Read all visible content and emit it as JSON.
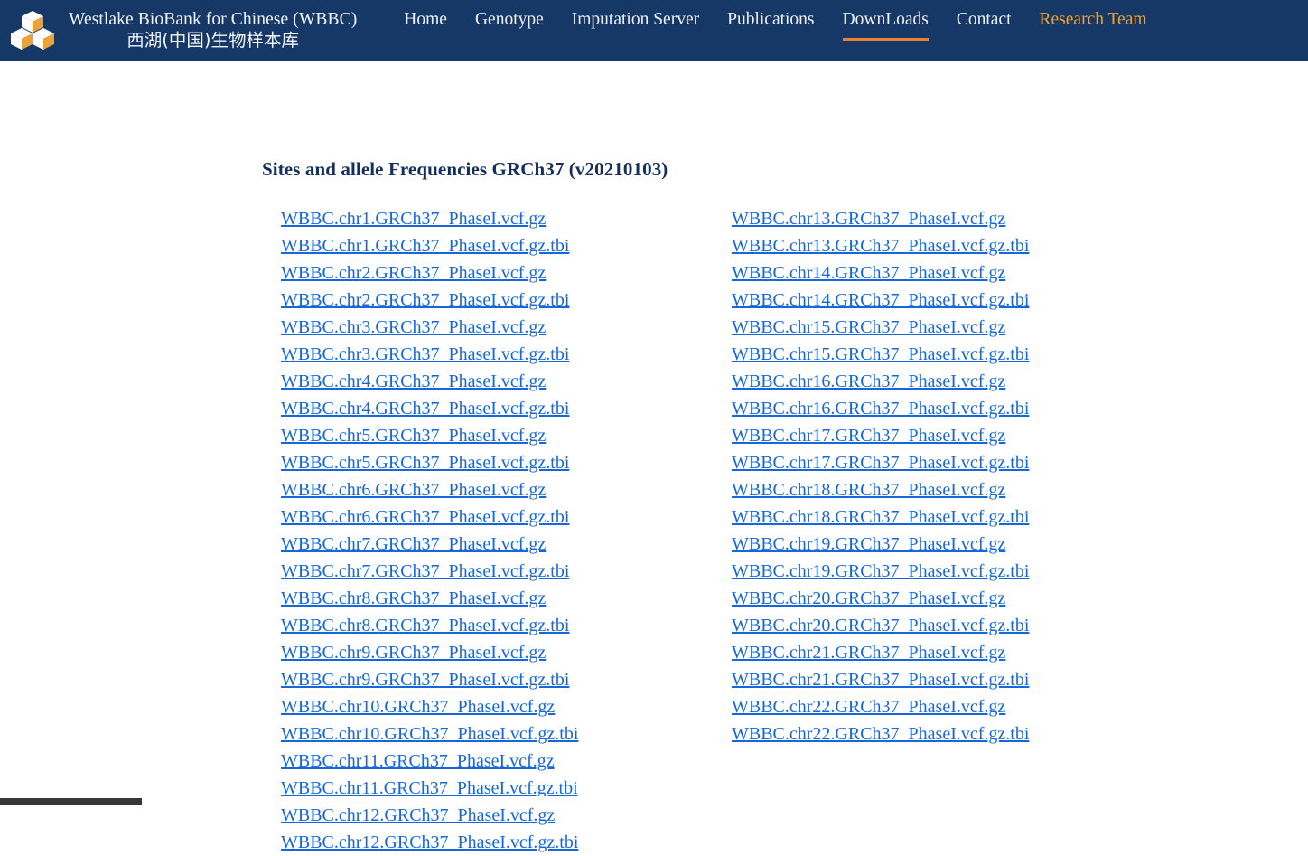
{
  "header": {
    "logo_icon": "three-cubes-logo-icon",
    "brand_title_en": "Westlake BioBank for Chinese (WBBC)",
    "brand_title_cn": "西湖(中国)生物样本库",
    "background_color": "#163867",
    "active_underline_color": "#e8803a",
    "accent_text_color": "#f0a32e",
    "nav": [
      {
        "label": "Home",
        "active": false,
        "accent": false
      },
      {
        "label": "Genotype",
        "active": false,
        "accent": false
      },
      {
        "label": "Imputation Server",
        "active": false,
        "accent": false
      },
      {
        "label": "Publications",
        "active": false,
        "accent": false
      },
      {
        "label": "DownLoads",
        "active": true,
        "accent": false
      },
      {
        "label": "Contact",
        "active": false,
        "accent": false
      },
      {
        "label": "Research Team",
        "active": false,
        "accent": true
      }
    ]
  },
  "main": {
    "heading": "Sites and allele Frequencies GRCh37 (v20210103)",
    "heading_color": "#132f5e",
    "link_color": "#1668da",
    "columns": [
      {
        "name": "chr1-chr12",
        "links": [
          "WBBC.chr1.GRCh37_PhaseI.vcf.gz",
          "WBBC.chr1.GRCh37_PhaseI.vcf.gz.tbi",
          "WBBC.chr2.GRCh37_PhaseI.vcf.gz",
          "WBBC.chr2.GRCh37_PhaseI.vcf.gz.tbi",
          "WBBC.chr3.GRCh37_PhaseI.vcf.gz",
          "WBBC.chr3.GRCh37_PhaseI.vcf.gz.tbi",
          "WBBC.chr4.GRCh37_PhaseI.vcf.gz",
          "WBBC.chr4.GRCh37_PhaseI.vcf.gz.tbi",
          "WBBC.chr5.GRCh37_PhaseI.vcf.gz",
          "WBBC.chr5.GRCh37_PhaseI.vcf.gz.tbi",
          "WBBC.chr6.GRCh37_PhaseI.vcf.gz",
          "WBBC.chr6.GRCh37_PhaseI.vcf.gz.tbi",
          "WBBC.chr7.GRCh37_PhaseI.vcf.gz",
          "WBBC.chr7.GRCh37_PhaseI.vcf.gz.tbi",
          "WBBC.chr8.GRCh37_PhaseI.vcf.gz",
          "WBBC.chr8.GRCh37_PhaseI.vcf.gz.tbi",
          "WBBC.chr9.GRCh37_PhaseI.vcf.gz",
          "WBBC.chr9.GRCh37_PhaseI.vcf.gz.tbi",
          "WBBC.chr10.GRCh37_PhaseI.vcf.gz",
          "WBBC.chr10.GRCh37_PhaseI.vcf.gz.tbi",
          "WBBC.chr11.GRCh37_PhaseI.vcf.gz",
          "WBBC.chr11.GRCh37_PhaseI.vcf.gz.tbi",
          "WBBC.chr12.GRCh37_PhaseI.vcf.gz",
          "WBBC.chr12.GRCh37_PhaseI.vcf.gz.tbi"
        ]
      },
      {
        "name": "chr13-chr22",
        "links": [
          "WBBC.chr13.GRCh37_PhaseI.vcf.gz",
          "WBBC.chr13.GRCh37_PhaseI.vcf.gz.tbi",
          "WBBC.chr14.GRCh37_PhaseI.vcf.gz",
          "WBBC.chr14.GRCh37_PhaseI.vcf.gz.tbi",
          "WBBC.chr15.GRCh37_PhaseI.vcf.gz",
          "WBBC.chr15.GRCh37_PhaseI.vcf.gz.tbi",
          "WBBC.chr16.GRCh37_PhaseI.vcf.gz",
          "WBBC.chr16.GRCh37_PhaseI.vcf.gz.tbi",
          "WBBC.chr17.GRCh37_PhaseI.vcf.gz",
          "WBBC.chr17.GRCh37_PhaseI.vcf.gz.tbi",
          "WBBC.chr18.GRCh37_PhaseI.vcf.gz",
          "WBBC.chr18.GRCh37_PhaseI.vcf.gz.tbi",
          "WBBC.chr19.GRCh37_PhaseI.vcf.gz",
          "WBBC.chr19.GRCh37_PhaseI.vcf.gz.tbi",
          "WBBC.chr20.GRCh37_PhaseI.vcf.gz",
          "WBBC.chr20.GRCh37_PhaseI.vcf.gz.tbi",
          "WBBC.chr21.GRCh37_PhaseI.vcf.gz",
          "WBBC.chr21.GRCh37_PhaseI.vcf.gz.tbi",
          "WBBC.chr22.GRCh37_PhaseI.vcf.gz",
          "WBBC.chr22.GRCh37_PhaseI.vcf.gz.tbi"
        ]
      }
    ]
  },
  "scrollbar": {
    "orientation": "horizontal",
    "thumb_color": "#37373a"
  }
}
